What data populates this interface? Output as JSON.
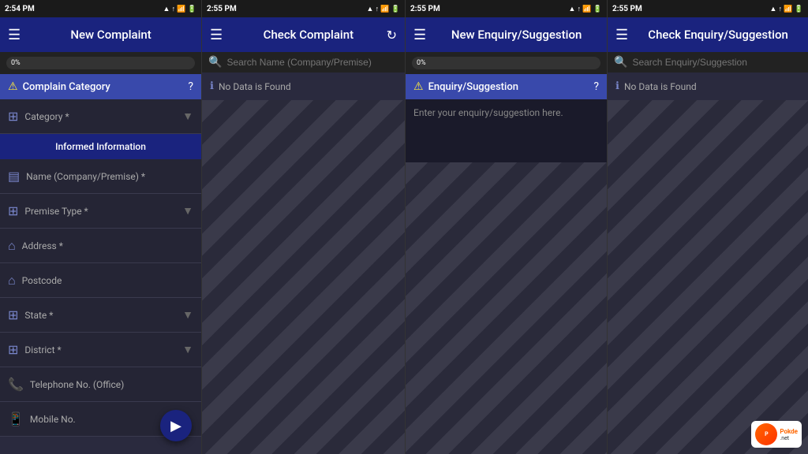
{
  "panels": {
    "panel1": {
      "statusbar": {
        "time": "2:54 PM",
        "icons": "● ● ■ ↑↓ ▲ 📶 🔋"
      },
      "header": {
        "title": "New Complaint",
        "menu_icon": "☰"
      },
      "progress": {
        "value": "0%",
        "percent": 0
      },
      "section": {
        "title": "Complain Category",
        "alert_icon": "!",
        "help_icon": "?"
      },
      "fields": [
        {
          "icon": "layers",
          "label": "Category *",
          "has_arrow": true
        },
        {
          "icon": "info",
          "label": "Informed Information",
          "is_button": true
        },
        {
          "icon": "business",
          "label": "Name (Company/Premise) *",
          "has_arrow": false
        },
        {
          "icon": "layers",
          "label": "Premise Type *",
          "has_arrow": true
        },
        {
          "icon": "home",
          "label": "Address *",
          "has_arrow": false
        },
        {
          "icon": "home",
          "label": "Postcode",
          "has_arrow": false
        },
        {
          "icon": "layers",
          "label": "State *",
          "has_arrow": true
        },
        {
          "icon": "layers",
          "label": "District *",
          "has_arrow": true
        },
        {
          "icon": "phone",
          "label": "Telephone No. (Office)",
          "has_arrow": false
        },
        {
          "icon": "phone",
          "label": "Mobile No.",
          "has_arrow": false
        }
      ],
      "fab": "▶"
    },
    "panel2": {
      "statusbar": {
        "time": "2:55 PM",
        "icons": "● ● ■ ↑↓ ▲ 📶 🔋"
      },
      "header": {
        "title": "Check Complaint",
        "menu_icon": "☰",
        "refresh_icon": "↻"
      },
      "search": {
        "placeholder": "Search Name (Company/Premise)"
      },
      "no_data": "No Data is Found"
    },
    "panel3": {
      "statusbar": {
        "time": "2:55 PM",
        "icons": "● ● ■ ↑↓ ▲ 📶 🔋"
      },
      "header": {
        "title": "New Enquiry/Suggestion",
        "menu_icon": "☰"
      },
      "progress": {
        "value": "0%",
        "percent": 0
      },
      "section": {
        "title": "Enquiry/Suggestion",
        "alert_icon": "!",
        "help_icon": "?"
      },
      "textarea_placeholder": "Enter your enquiry/suggestion here."
    },
    "panel4": {
      "statusbar": {
        "time": "2:55 PM",
        "icons": "● ● ■ ↑↓ ▲ 📶 🔋"
      },
      "header": {
        "title": "Check Enquiry/Suggestion",
        "menu_icon": "☰"
      },
      "search": {
        "placeholder": "Search Enquiry/Suggestion"
      },
      "no_data": "No Data is Found"
    }
  }
}
